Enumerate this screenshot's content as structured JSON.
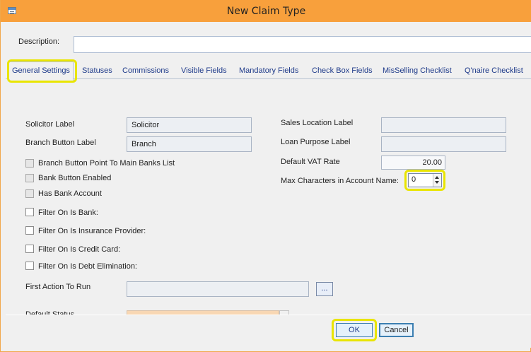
{
  "window": {
    "title": "New Claim Type"
  },
  "form": {
    "description_label": "Description:",
    "description_value": ""
  },
  "tabs": [
    {
      "label": "General Settings",
      "active": true,
      "highlighted": true
    },
    {
      "label": "Statuses"
    },
    {
      "label": "Commissions"
    },
    {
      "label": "Visible Fields"
    },
    {
      "label": "Mandatory Fields"
    },
    {
      "label": "Check Box Fields"
    },
    {
      "label": "MisSelling Checklist"
    },
    {
      "label": "Q'naire Checklist"
    }
  ],
  "general": {
    "solicitor_label": {
      "label": "Solicitor Label",
      "value": "Solicitor"
    },
    "branch_button_label": {
      "label": "Branch Button Label",
      "value": "Branch"
    },
    "sales_location_label": {
      "label": "Sales Location Label",
      "value": ""
    },
    "loan_purpose_label": {
      "label": "Loan Purpose Label",
      "value": ""
    },
    "default_vat_rate": {
      "label": "Default VAT Rate",
      "value": "20.00"
    },
    "max_characters": {
      "label": "Max Characters in Account Name:",
      "value": "0",
      "highlighted": true
    },
    "checkboxes": [
      {
        "label": "Branch Button Point To Main Banks List",
        "checked": false,
        "disabled": true
      },
      {
        "label": "Bank Button Enabled",
        "checked": false,
        "disabled": true
      },
      {
        "label": "Has Bank Account",
        "checked": false,
        "disabled": true
      },
      {
        "label": "Filter On Is Bank:",
        "checked": false,
        "disabled": false
      },
      {
        "label": "Filter On Is Insurance Provider:",
        "checked": false,
        "disabled": false
      },
      {
        "label": "Filter On Is Credit Card:",
        "checked": false,
        "disabled": false
      },
      {
        "label": "Filter On Is Debt Elimination:",
        "checked": false,
        "disabled": false
      }
    ],
    "first_action": {
      "label": "First Action To Run",
      "value": "",
      "browse_label": "..."
    },
    "default_status": {
      "label": "Default Status"
    }
  },
  "buttons": {
    "ok": "OK",
    "cancel": "Cancel"
  },
  "colors": {
    "titlebar": "#f8a03c",
    "highlight": "#e9e500",
    "tab_text": "#1f3b8a"
  }
}
